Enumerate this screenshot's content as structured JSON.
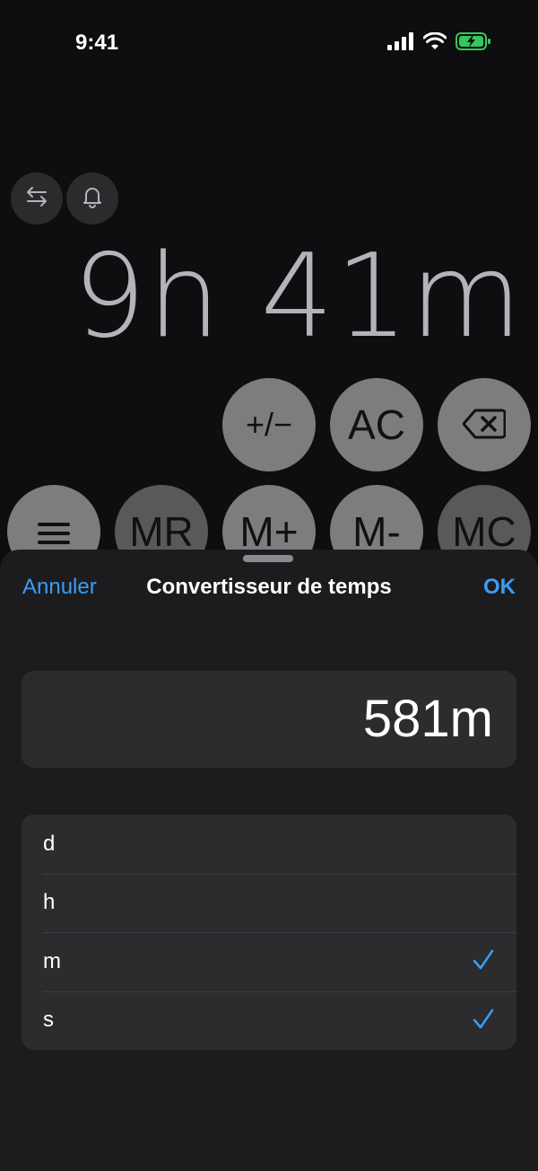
{
  "status_bar": {
    "time": "9:41"
  },
  "display": {
    "value": "9h 41m"
  },
  "keys": {
    "row1": [
      "+/−",
      "AC",
      "⌫"
    ],
    "row2": [
      "≡",
      "MR",
      "M+",
      "M-",
      "MC"
    ]
  },
  "sheet": {
    "cancel_label": "Annuler",
    "title": "Convertisseur de temps",
    "ok_label": "OK",
    "value": "581m",
    "units": [
      {
        "label": "d",
        "checked": false
      },
      {
        "label": "h",
        "checked": false
      },
      {
        "label": "m",
        "checked": true
      },
      {
        "label": "s",
        "checked": true
      }
    ]
  },
  "colors": {
    "accent": "#3a9df6",
    "battery": "#34c759"
  }
}
